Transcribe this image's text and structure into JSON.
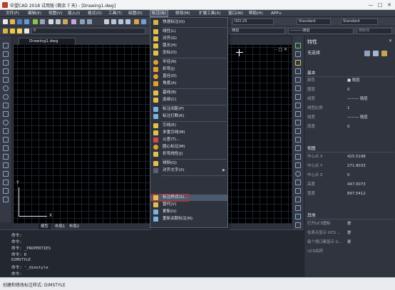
{
  "window": {
    "title": "中望CAD 2018 试用版 (剩余 7 天) - [Drawing1.dwg]",
    "minimize": "—",
    "maximize": "□",
    "close": "✕"
  },
  "menu": [
    {
      "label": "文件(F)"
    },
    {
      "label": "编辑(E)"
    },
    {
      "label": "视图(V)"
    },
    {
      "label": "插入(I)"
    },
    {
      "label": "格式(O)"
    },
    {
      "label": "工具(T)"
    },
    {
      "label": "绘图(D)"
    },
    {
      "label": "标注(N)"
    },
    {
      "label": "修改(M)"
    },
    {
      "label": "扩展工具(X)"
    },
    {
      "label": "窗口(W)"
    },
    {
      "label": "帮助(H)"
    },
    {
      "label": "APP+"
    }
  ],
  "toolbar": {
    "layer_combo": "0",
    "dimstyle_combo": "ISO-25",
    "textstyle_combo": "Standard",
    "tablestyle_combo": "Standard",
    "linetype_combo": "——— 随层",
    "lineweight_combo": "——— 随层",
    "color_combo": "随层",
    "plotstyle_combo": "随颜色"
  },
  "document": {
    "tab": "Drawing1.dwg",
    "viewport_controls": "- □ ✕",
    "ucs_x": "X",
    "ucs_y": "Y"
  },
  "model_tabs": {
    "model": "模型",
    "layout1": "布局1",
    "layout2": "布局2"
  },
  "dimension_menu": {
    "items": [
      {
        "label": "快速标注(Q)"
      },
      {
        "label": "线性(L)"
      },
      {
        "label": "对齐(G)"
      },
      {
        "label": "弧长(H)"
      },
      {
        "label": "坐标(O)"
      },
      {
        "label": "半径(R)"
      },
      {
        "label": "折弯(J)"
      },
      {
        "label": "直径(D)"
      },
      {
        "label": "角度(A)"
      },
      {
        "label": "基线(B)"
      },
      {
        "label": "连续(C)"
      },
      {
        "label": "标注间距(P)"
      },
      {
        "label": "标注打断(K)"
      },
      {
        "label": "引线(E)"
      },
      {
        "label": "多重引线(M)"
      },
      {
        "label": "公差(T)..."
      },
      {
        "label": "圆心标记(M)"
      },
      {
        "label": "折弯线性(J)"
      },
      {
        "label": "倾斜(Q)"
      },
      {
        "label": "对齐文字(X)"
      },
      {
        "label": "标注样式(S)..."
      },
      {
        "label": "替代(V)"
      },
      {
        "label": "更新(U)"
      },
      {
        "label": "重新关联标注(N)"
      }
    ],
    "submenu_arrow": "▶"
  },
  "properties": {
    "title": "特性",
    "selection": "无选择",
    "sections": {
      "basic": "基本",
      "view": "视图",
      "misc": "其他"
    },
    "basic_rows": [
      {
        "label": "颜色",
        "value": "■ 随层"
      },
      {
        "label": "图层",
        "value": "0"
      },
      {
        "label": "线型",
        "value": "——— 随层"
      },
      {
        "label": "线型比例",
        "value": "1"
      },
      {
        "label": "线宽",
        "value": "——— 随层"
      },
      {
        "label": "厚度",
        "value": "0"
      }
    ],
    "view_rows": [
      {
        "label": "中心点 X",
        "value": "425.5198"
      },
      {
        "label": "中心点 Y",
        "value": "271.8033"
      },
      {
        "label": "中心点 Z",
        "value": "0"
      },
      {
        "label": "高度",
        "value": "447.0073"
      },
      {
        "label": "宽度",
        "value": "897.5412"
      }
    ],
    "misc_rows": [
      {
        "label": "打开UCS图标",
        "value": "是"
      },
      {
        "label": "在原点显示 UCS ...",
        "value": "是"
      },
      {
        "label": "每个视口都显示 U...",
        "value": "是"
      },
      {
        "label": "UCS名称",
        "value": ""
      }
    ]
  },
  "command": {
    "lines": [
      "命令:",
      "命令:",
      "命令: _PROPERTIES",
      "命令: D",
      "DIMSTYLE",
      "命令: '_dimstyle",
      "命令:"
    ]
  },
  "status": {
    "text": "创建和修改标注样式: DIMSTYLE"
  },
  "colors": {
    "highlight_box": "#e02020",
    "canvas": "#000000",
    "panel": "#2f343e"
  }
}
